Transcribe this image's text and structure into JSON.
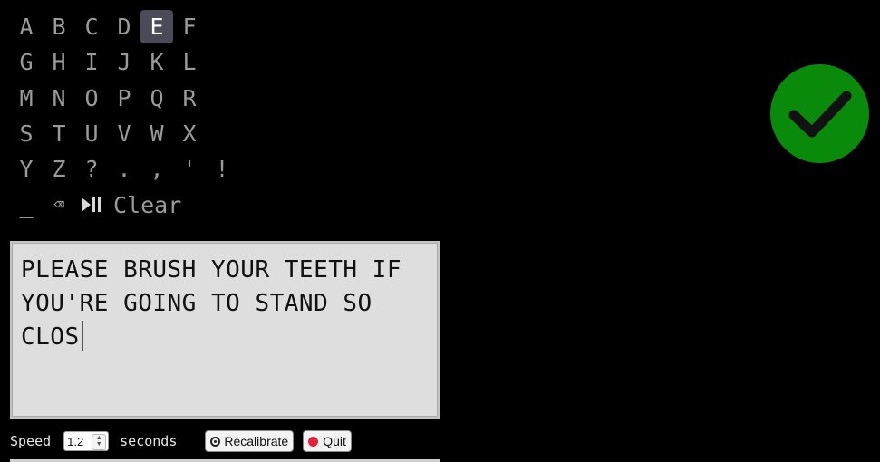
{
  "keyboard": {
    "rows": [
      [
        "A",
        "B",
        "C",
        "D",
        "E",
        "F"
      ],
      [
        "G",
        "H",
        "I",
        "J",
        "K",
        "L"
      ],
      [
        "M",
        "N",
        "O",
        "P",
        "Q",
        "R"
      ],
      [
        "S",
        "T",
        "U",
        "V",
        "W",
        "X"
      ],
      [
        "Y",
        "Z",
        "?",
        ".",
        ",",
        "'",
        "!"
      ]
    ],
    "active_key": "E",
    "space_label": "_",
    "backspace_label": "⌫",
    "play_pause_icon": "play-pause-icon",
    "clear_label": "Clear"
  },
  "text_output": {
    "value": "PLEASE BRUSH YOUR TEETH IF YOU'RE GOING TO STAND SO CLOS"
  },
  "status": {
    "icon": "checkmark-icon",
    "color": "#0a8a0a"
  },
  "controls": {
    "speed_label": "Speed",
    "speed_value": "1.2",
    "seconds_label": "seconds",
    "recalibrate_label": "Recalibrate",
    "quit_label": "Quit"
  }
}
